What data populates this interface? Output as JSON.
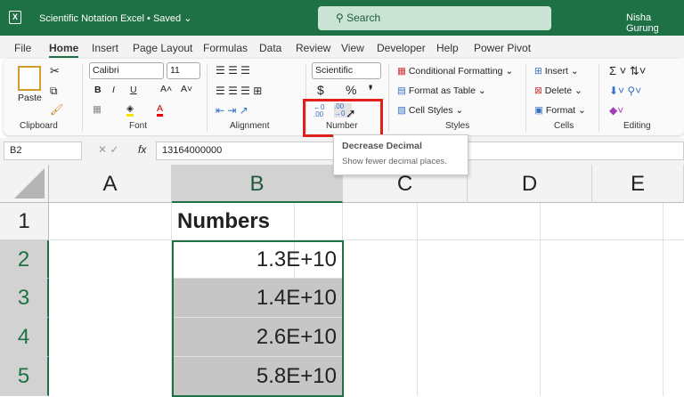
{
  "titlebar": {
    "logo": "X",
    "document": "Scientific Notation Excel • Saved ⌄",
    "search": "Search",
    "user": "Nisha Gurung"
  },
  "menu": [
    "File",
    "Home",
    "Insert",
    "Page Layout",
    "Formulas",
    "Data",
    "Review",
    "View",
    "Developer",
    "Help",
    "Power Pivot"
  ],
  "ribbon": {
    "clipboard": {
      "paste": "Paste",
      "label": "Clipboard"
    },
    "font": {
      "name": "Calibri",
      "size": "11",
      "bold": "B",
      "italic": "I",
      "underline": "U",
      "label": "Font"
    },
    "alignment": {
      "label": "Alignment"
    },
    "number": {
      "format": "Scientific",
      "currency": "$",
      "percent": "%",
      "comma": "❜",
      "increase": "←0 .00",
      "decrease": ".00 →0",
      "label": "Number"
    },
    "styles": {
      "conditional": "Conditional Formatting ⌄",
      "table": "Format as Table ⌄",
      "cell": "Cell Styles ⌄",
      "label": "Styles"
    },
    "cells": {
      "insert": "Insert ⌄",
      "delete": "Delete ⌄",
      "format": "Format ⌄",
      "label": "Cells"
    },
    "editing": {
      "label": "Editing"
    }
  },
  "tooltip": {
    "title": "Decrease Decimal",
    "desc": "Show fewer decimal places."
  },
  "formula_bar": {
    "name_box": "B2",
    "formula": "13164000000",
    "fx": "fx"
  },
  "sheet": {
    "columns": [
      "A",
      "B",
      "C",
      "D",
      "E"
    ],
    "rows": [
      "1",
      "2",
      "3",
      "4",
      "5"
    ],
    "b": [
      "Numbers",
      "1.3E+10",
      "1.4E+10",
      "2.6E+10",
      "5.8E+10"
    ]
  },
  "colors": {
    "brand": "#1e7145",
    "highlight": "#e0201a"
  }
}
